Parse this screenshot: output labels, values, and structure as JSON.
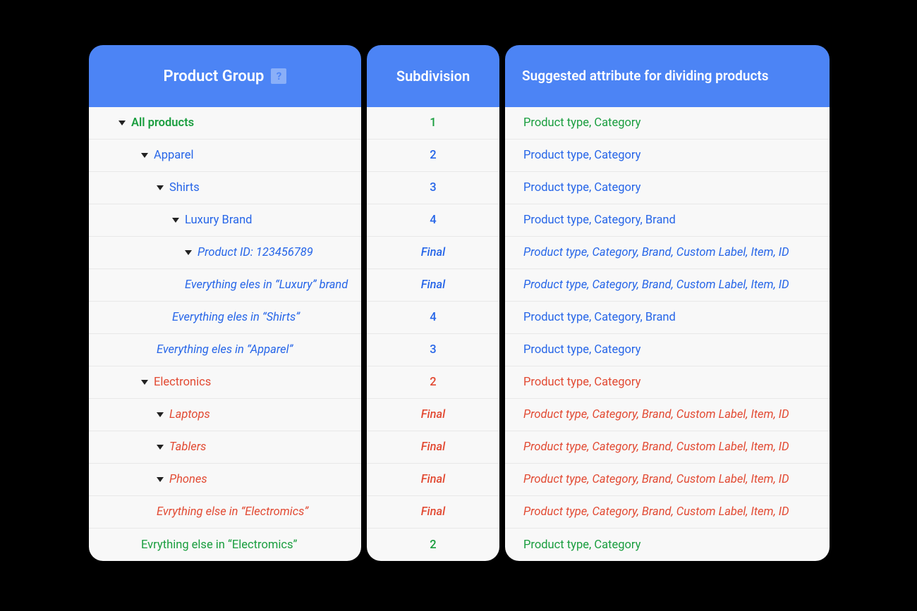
{
  "headers": {
    "product_group": "Product Group",
    "help_glyph": "?",
    "subdivision": "Subdivision",
    "suggested": "Suggested attribute for dividing products"
  },
  "rows": [
    {
      "indent": 0,
      "caret": true,
      "italic": false,
      "color": "green",
      "label": "All products",
      "sub": "1",
      "attr": "Product type, Category"
    },
    {
      "indent": 1,
      "caret": true,
      "italic": false,
      "color": "blue",
      "label": "Apparel",
      "sub": "2",
      "attr": "Product type, Category"
    },
    {
      "indent": 2,
      "caret": true,
      "italic": false,
      "color": "blue",
      "label": "Shirts",
      "sub": "3",
      "attr": "Product type, Category"
    },
    {
      "indent": 3,
      "caret": true,
      "italic": false,
      "color": "blue",
      "label": "Luxury Brand",
      "sub": "4",
      "attr": "Product type, Category, Brand"
    },
    {
      "indent": 4,
      "caret": true,
      "italic": true,
      "color": "blue",
      "label": "Product ID: 123456789",
      "sub": "Final",
      "attr": "Product type, Category, Brand, Custom Label, Item, ID"
    },
    {
      "indent": 4,
      "caret": false,
      "italic": true,
      "color": "blue",
      "label": "Everything eles in “Luxury” brand",
      "sub": "Final",
      "attr": "Product type, Category, Brand, Custom Label, Item, ID"
    },
    {
      "indent": 3,
      "caret": false,
      "italic": true,
      "color": "blue",
      "label": "Everything eles in “Shirts”",
      "sub": "4",
      "attr": "Product type, Category, Brand"
    },
    {
      "indent": 2,
      "caret": false,
      "italic": true,
      "color": "blue",
      "label": "Everything eles in “Apparel”",
      "sub": "3",
      "attr": "Product type, Category"
    },
    {
      "indent": 1,
      "caret": true,
      "italic": false,
      "color": "red",
      "label": "Electronics",
      "sub": "2",
      "attr": "Product type, Category"
    },
    {
      "indent": 2,
      "caret": true,
      "italic": true,
      "color": "red",
      "label": "Laptops",
      "sub": "Final",
      "attr": "Product type, Category, Brand, Custom Label, Item, ID"
    },
    {
      "indent": 2,
      "caret": true,
      "italic": true,
      "color": "red",
      "label": "Tablers",
      "sub": "Final",
      "attr": "Product type, Category, Brand, Custom Label, Item, ID"
    },
    {
      "indent": 2,
      "caret": true,
      "italic": true,
      "color": "red",
      "label": "Phones",
      "sub": "Final",
      "attr": "Product type, Category, Brand, Custom Label, Item, ID"
    },
    {
      "indent": 2,
      "caret": false,
      "italic": true,
      "color": "red",
      "label": "Evrything else in “Electromics”",
      "sub": "Final",
      "attr": "Product type, Category, Brand, Custom Label, Item, ID"
    },
    {
      "indent": 1,
      "caret": false,
      "italic": false,
      "color": "green",
      "label": "Evrything else in “Electromics”",
      "sub": "2",
      "attr": "Product type, Category"
    }
  ],
  "colors": {
    "green": "#1a9e3f",
    "blue": "#2766e8",
    "red": "#e24a33",
    "header_bg": "#4c84f5"
  }
}
